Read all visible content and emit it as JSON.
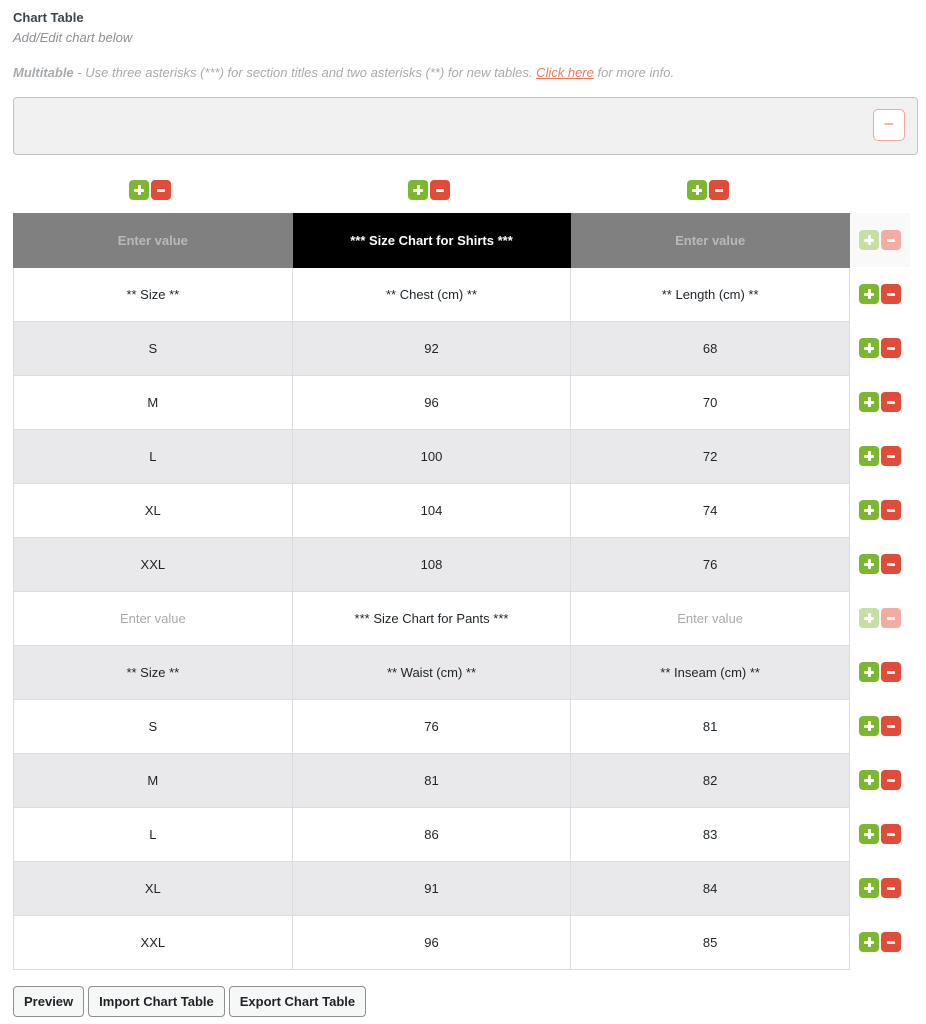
{
  "header": {
    "title": "Chart Table",
    "subtitle": "Add/Edit chart below",
    "info": {
      "label": "Multitable",
      "text_before": " - Use three asterisks (***) for section titles and two asterisks (**) for new tables. ",
      "link": "Click here",
      "text_after": " for more info."
    }
  },
  "section_box": {
    "collapse_icon": "minus-icon"
  },
  "table": {
    "placeholder": "Enter value",
    "rows": [
      {
        "type": "head",
        "cells": [
          "",
          "*** Size Chart for Shirts ***",
          ""
        ]
      },
      {
        "type": "white",
        "cells": [
          "** Size **",
          "** Chest (cm) **",
          "** Length (cm) **"
        ]
      },
      {
        "type": "shade",
        "cells": [
          "S",
          "92",
          "68"
        ]
      },
      {
        "type": "white",
        "cells": [
          "M",
          "96",
          "70"
        ]
      },
      {
        "type": "shade",
        "cells": [
          "L",
          "100",
          "72"
        ]
      },
      {
        "type": "white",
        "cells": [
          "XL",
          "104",
          "74"
        ]
      },
      {
        "type": "shade",
        "cells": [
          "XXL",
          "108",
          "76"
        ]
      },
      {
        "type": "white",
        "cells": [
          "",
          "*** Size Chart for Pants ***",
          ""
        ]
      },
      {
        "type": "shade",
        "cells": [
          "** Size **",
          "** Waist (cm) **",
          "** Inseam (cm) **"
        ]
      },
      {
        "type": "white",
        "cells": [
          "S",
          "76",
          "81"
        ]
      },
      {
        "type": "shade",
        "cells": [
          "M",
          "81",
          "82"
        ]
      },
      {
        "type": "white",
        "cells": [
          "L",
          "86",
          "83"
        ]
      },
      {
        "type": "shade",
        "cells": [
          "XL",
          "91",
          "84"
        ]
      },
      {
        "type": "white",
        "cells": [
          "XXL",
          "96",
          "85"
        ]
      }
    ]
  },
  "colors": {
    "add": "#7cb82f",
    "remove": "#e04b3a",
    "link": "#f0785a"
  },
  "footer": {
    "preview": "Preview",
    "import": "Import Chart Table",
    "export": "Export Chart Table"
  }
}
